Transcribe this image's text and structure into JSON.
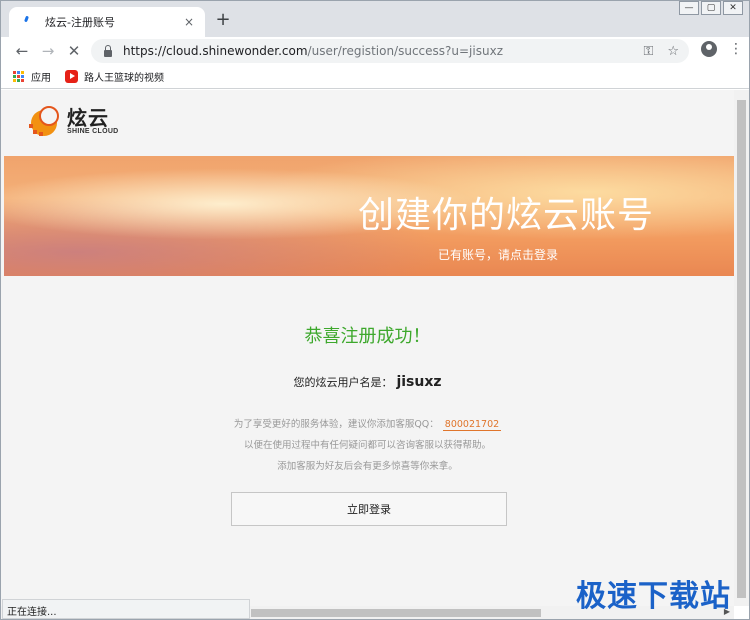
{
  "browser": {
    "tab_title": "炫云-注册账号",
    "tab_close": "×",
    "new_tab": "+",
    "url_domain": "https://cloud.shinewonder.com",
    "url_path": "/user/registion/success?u=jisuxz",
    "back_icon": "←",
    "forward_icon": "→",
    "stop_icon": "✕",
    "key_icon": "⚿",
    "star_icon": "☆",
    "menu_icon": "⋮",
    "window_min": "—",
    "window_max": "▢",
    "window_close": "✕",
    "bookmarks": [
      {
        "label": "应用",
        "icon": "apps-icon"
      },
      {
        "label": "路人王篮球的视频",
        "icon": "youtube-icon"
      }
    ],
    "status_text": "正在连接..."
  },
  "site": {
    "logo_cn": "炫云",
    "logo_en": "SHINE CLOUD",
    "banner_title": "创建你的炫云账号",
    "banner_subtitle": "已有账号，请点击登录"
  },
  "main": {
    "success_message": "恭喜注册成功！",
    "username_label": "您的炫云用户名是：",
    "username": "jisuxz",
    "info_line1": "为了享受更好的服务体验，建议你添加客服QQ：",
    "qq_number": "800021702",
    "info_line2": "以便在使用过程中有任何疑问都可以咨询客服以获得帮助。",
    "info_line3": "添加客服为好友后会有更多惊喜等你来拿。",
    "login_button": "立即登录"
  },
  "watermark": "极速下载站",
  "colors": {
    "success_green": "#3da82c",
    "qq_orange": "#e0752b",
    "watermark_blue": "#1b62c8"
  }
}
